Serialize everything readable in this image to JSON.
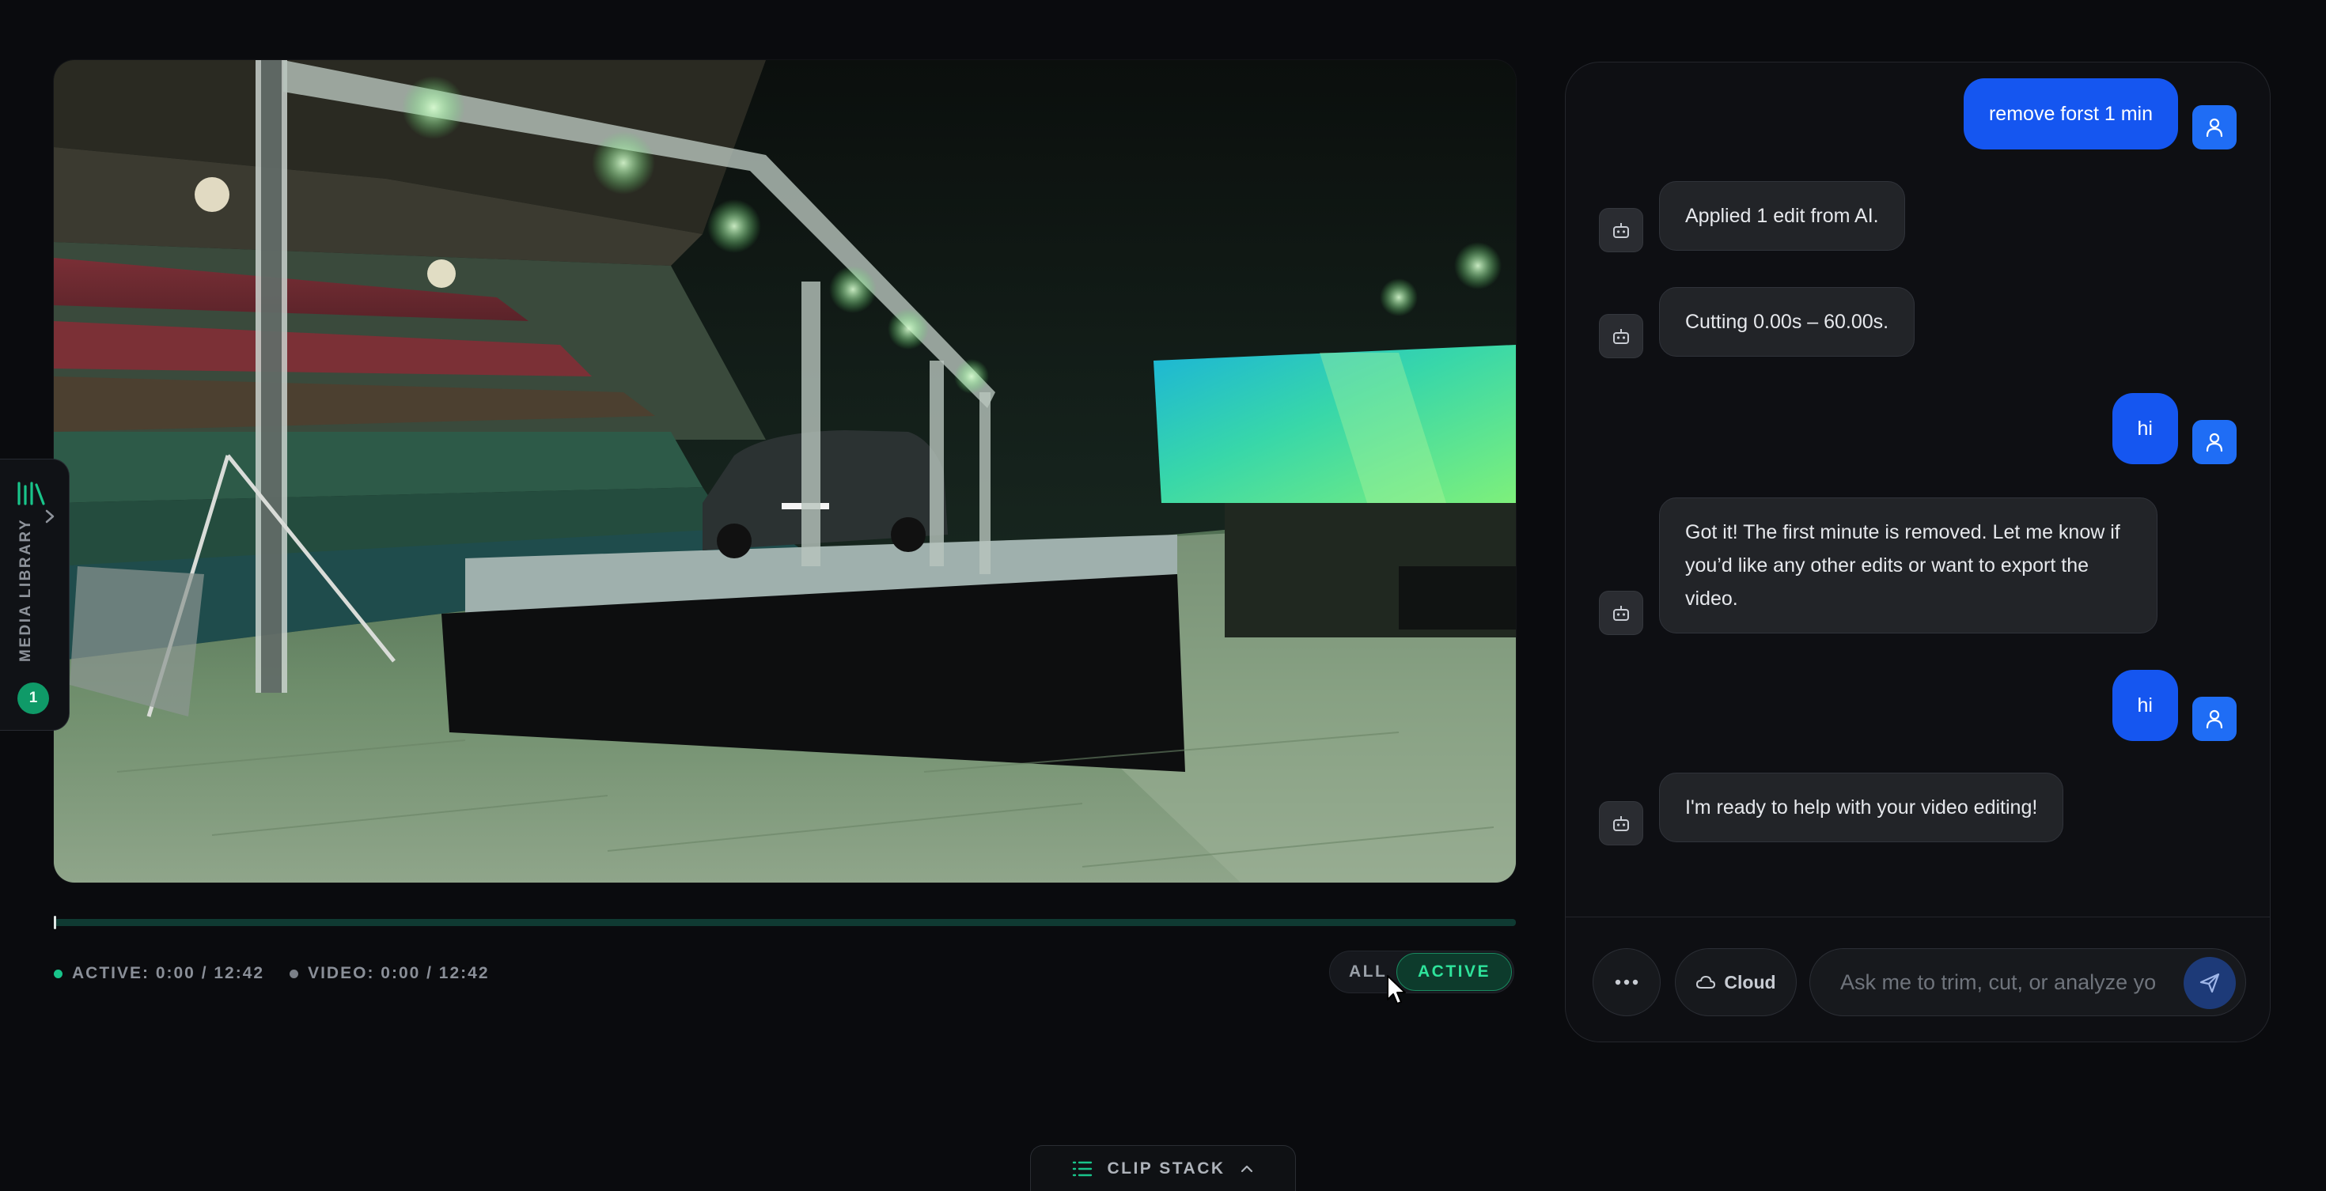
{
  "player": {
    "active_time": "ACTIVE: 0:00 / 12:42",
    "video_time": "VIDEO: 0:00 / 12:42",
    "progress": 0,
    "filter": {
      "all_label": "ALL",
      "active_label": "ACTIVE",
      "selected": "ACTIVE"
    }
  },
  "media_library": {
    "label": "MEDIA LIBRARY",
    "count": "1"
  },
  "chat": {
    "messages": [
      {
        "role": "user",
        "text": "remove forst 1 min"
      },
      {
        "role": "assistant",
        "text": "Applied 1 edit from AI."
      },
      {
        "role": "assistant",
        "text": "Cutting 0.00s – 60.00s."
      },
      {
        "role": "user",
        "text": "hi"
      },
      {
        "role": "assistant",
        "text": "Got it! The first minute is removed. Let me know if you’d like any other edits or want to export the video."
      },
      {
        "role": "user",
        "text": "hi"
      },
      {
        "role": "assistant",
        "text": "I'm ready to help with your video editing!"
      }
    ],
    "input": {
      "placeholder": "Ask me to trim, cut, or analyze your video...",
      "value": ""
    },
    "cloud_label": "Cloud"
  },
  "clip_stack": {
    "label": "CLIP STACK"
  },
  "icons": {
    "media_library": "library-icon",
    "expand": "chevron-right-icon",
    "more": "ellipsis-icon",
    "cloud": "cloud-icon",
    "send": "send-icon",
    "user": "user-icon",
    "bot": "bot-icon",
    "clip_stack": "list-icon",
    "clip_stack_toggle": "chevron-up-icon"
  },
  "colors": {
    "accent_green": "#2ee39b",
    "user_bubble": "#1556f0",
    "background": "#0a0b0e"
  }
}
